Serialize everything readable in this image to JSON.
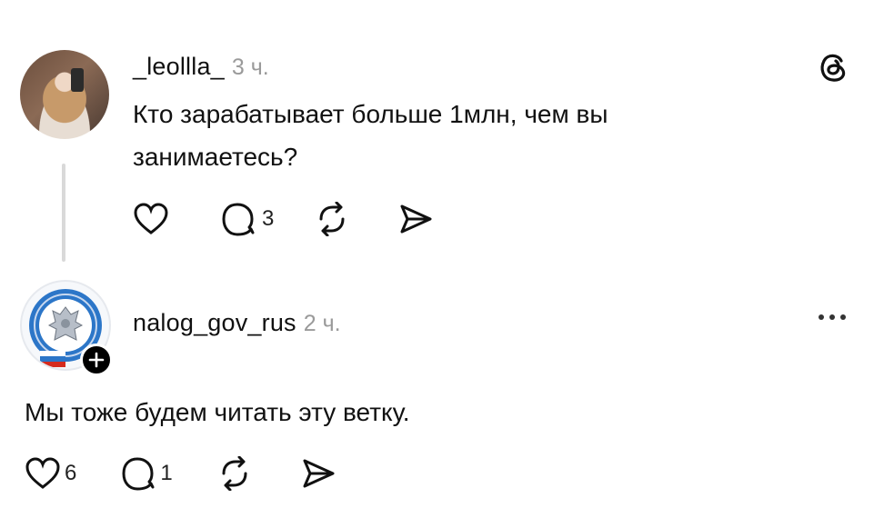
{
  "post1": {
    "username": "_leollla_",
    "time": "3 ч.",
    "text": "Кто зарабатывает больше 1млн, чем вы занимаетесь?",
    "reply_count": "3"
  },
  "post2": {
    "username": "nalog_gov_rus",
    "time": "2 ч.",
    "text": "Мы тоже будем читать эту ветку.",
    "like_count": "6",
    "reply_count": "1"
  },
  "icons": {
    "app_logo": "threads-logo-icon",
    "more": "more-options-icon",
    "like": "heart-icon",
    "reply": "comment-icon",
    "repost": "repost-icon",
    "share": "send-icon",
    "follow": "plus-icon"
  },
  "colors": {
    "text": "#111111",
    "muted": "#9a9a9a",
    "thread_line": "#d9d9d9"
  }
}
